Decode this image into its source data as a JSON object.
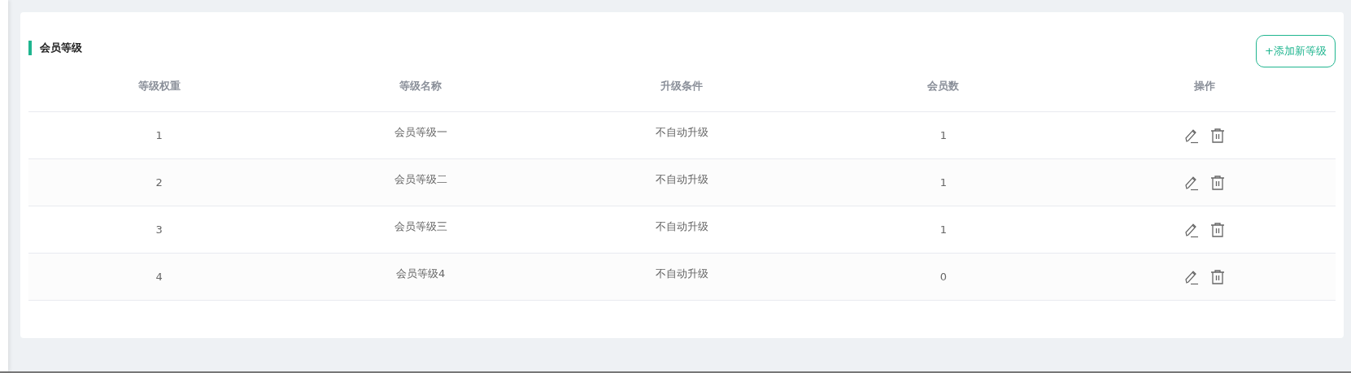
{
  "section": {
    "title": "会员等级",
    "add_button": "+添加新等级"
  },
  "table": {
    "columns": [
      "等级权重",
      "等级名称",
      "升级条件",
      "会员数",
      "操作"
    ],
    "rows": [
      {
        "weight": "1",
        "name": "会员等级一",
        "condition": "不自动升级",
        "members": "1"
      },
      {
        "weight": "2",
        "name": "会员等级二",
        "condition": "不自动升级",
        "members": "1"
      },
      {
        "weight": "3",
        "name": "会员等级三",
        "condition": "不自动升级",
        "members": "1"
      },
      {
        "weight": "4",
        "name": "会员等级4",
        "condition": "不自动升级",
        "members": "0"
      }
    ]
  }
}
